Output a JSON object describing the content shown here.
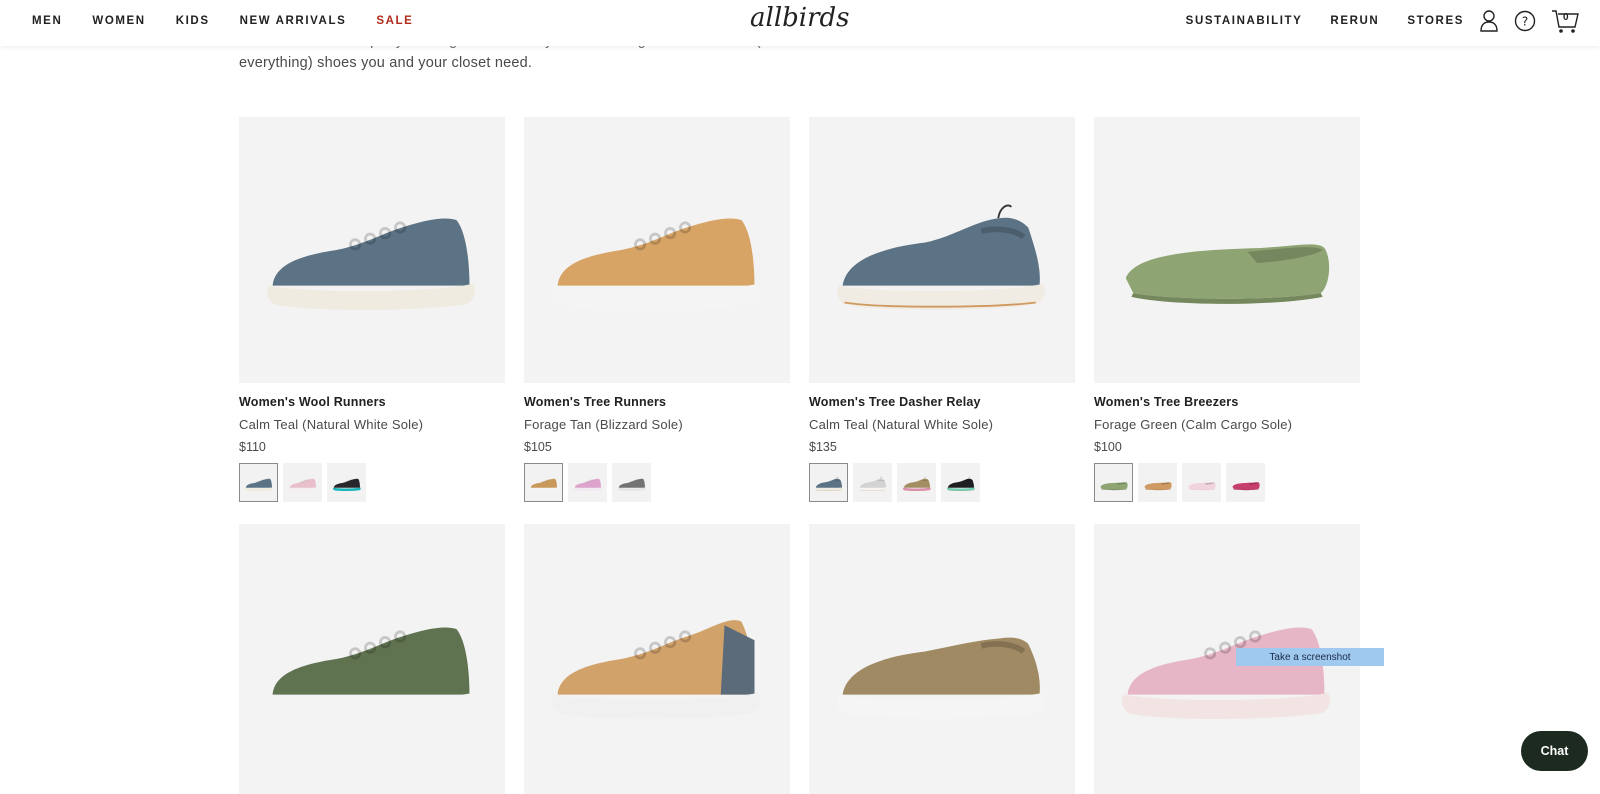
{
  "header": {
    "nav_left": [
      "MEN",
      "WOMEN",
      "KIDS",
      "NEW ARRIVALS",
      "SALE"
    ],
    "logo": "allbirds",
    "nav_right": [
      "SUSTAINABILITY",
      "RERUN",
      "STORES"
    ],
    "cart_count": "0",
    "icons": [
      "user-icon",
      "help-icon",
      "cart-icon"
    ],
    "sale_color": "#b22a1b"
  },
  "intro": {
    "line1": "Classic sneakers. Sporty running shoes. Comfy flats. We've got the \"I can do\" (with",
    "line2": "everything) shoes you and your closet need."
  },
  "products": [
    {
      "name": "Women's Wool Runners",
      "color": "Calm Teal (Natural White Sole)",
      "price": "$110",
      "shoe": {
        "upper": "#5b7385",
        "sole": "#efebe0",
        "style": "runner"
      },
      "swatches": [
        {
          "upper": "#5b7385",
          "sole": "#efebe0"
        },
        {
          "upper": "#e8bfcb",
          "sole": "#f5eef0"
        },
        {
          "upper": "#26262b",
          "sole": "#1ab3b8"
        }
      ]
    },
    {
      "name": "Women's Tree Runners",
      "color": "Forage Tan (Blizzard Sole)",
      "price": "$105",
      "shoe": {
        "upper": "#d7a466",
        "sole": "#f4f4f4",
        "style": "runner"
      },
      "swatches": [
        {
          "upper": "#c8995a",
          "sole": "#f4f4f4"
        },
        {
          "upper": "#dda3cd",
          "sole": "#f2e8ef"
        },
        {
          "upper": "#737373",
          "sole": "#e6e6e6"
        }
      ]
    },
    {
      "name": "Women's Tree Dasher Relay",
      "color": "Calm Teal (Natural White Sole)",
      "price": "$135",
      "shoe": {
        "upper": "#5b7385",
        "sole": "#f1ece3",
        "style": "slipon-high"
      },
      "swatches": [
        {
          "upper": "#5b7385",
          "sole": "#efebe0"
        },
        {
          "upper": "#d3d3d3",
          "sole": "#f4f4f4"
        },
        {
          "upper": "#a38d62",
          "sole": "#dd8fb0"
        },
        {
          "upper": "#1e1e22",
          "sole": "#6dd0b5"
        }
      ]
    },
    {
      "name": "Women's Tree Breezers",
      "color": "Forage Green (Calm Cargo Sole)",
      "price": "$100",
      "shoe": {
        "upper": "#8ea573",
        "sole": "#75875c",
        "style": "flat"
      },
      "swatches": [
        {
          "upper": "#8ea573",
          "sole": "#75875c"
        },
        {
          "upper": "#cf9a63",
          "sole": "#b8844e"
        },
        {
          "upper": "#f0d4dc",
          "sole": "#e9c4cf"
        },
        {
          "upper": "#c53e6d",
          "sole": "#a6315a"
        }
      ]
    },
    {
      "shoe": {
        "upper": "#5f7350",
        "sole": "#f3f3f3",
        "style": "runner"
      }
    },
    {
      "shoe": {
        "upper": "#d2a26b",
        "sole": "#f0f0f0",
        "style": "runner-high"
      }
    },
    {
      "shoe": {
        "upper": "#a08a63",
        "sole": "#f5f5f5",
        "style": "slipon"
      }
    },
    {
      "shoe": {
        "upper": "#e7b6c6",
        "sole": "#f3e4e4",
        "style": "runner"
      }
    }
  ],
  "tooltip": "Take a screenshot",
  "chat_label": "Chat"
}
